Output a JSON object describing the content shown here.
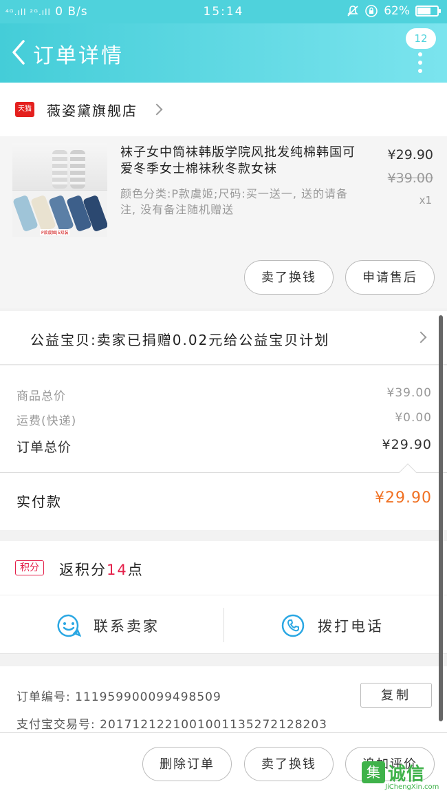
{
  "status_bar": {
    "signal_left": "⁴ᴳ.ıll ²ᴳ.ıll",
    "network_speed": "0 B/s",
    "time": "15:14",
    "battery_percent": "62%",
    "battery_level": 0.62
  },
  "header": {
    "title": "订单详情",
    "badge": "12"
  },
  "store": {
    "badge": "天猫",
    "name": "薇姿黛旗舰店"
  },
  "product": {
    "title": "袜子女中筒袜韩版学院风批发纯棉韩国可爱冬季女士棉袜秋冬款女袜",
    "spec": "颜色分类:P款虞姬;尺码:买一送一, 送的请备注, 没有备注随机赠送",
    "price": "¥29.90",
    "original_price": "¥39.00",
    "quantity": "x1",
    "thumb_caption": "P款虞姬|5双装",
    "buttons": [
      "卖了换钱",
      "申请售后"
    ]
  },
  "charity": {
    "text": "公益宝贝:卖家已捐赠0.02元给公益宝贝计划"
  },
  "totals": {
    "goods_label": "商品总价",
    "goods_value": "¥39.00",
    "shipping_label": "运费(快递)",
    "shipping_value": "¥0.00",
    "order_label": "订单总价",
    "order_value": "¥29.90"
  },
  "paid": {
    "label": "实付款",
    "value": "¥29.90"
  },
  "points": {
    "badge": "积分",
    "prefix": "返积分",
    "number": "14",
    "suffix": "点"
  },
  "contact": {
    "seller": "联系卖家",
    "phone": "拨打电话"
  },
  "order_info": {
    "order_no_line": "订单编号: 1119599000994985​09",
    "alipay_line": "支付宝交易号: 2017121221001001135272128203",
    "copy_button": "复制"
  },
  "bottom_bar": {
    "buttons": [
      "删除订单",
      "卖了换钱",
      "追加评价"
    ]
  },
  "watermark": {
    "mark": "集",
    "text": "诚信",
    "url": "JiChengXin.com"
  },
  "colors": {
    "header": "#4fd2dc",
    "accent_orange": "#f07022",
    "points_red": "#e4204a",
    "tmall_red": "#e4201e"
  }
}
